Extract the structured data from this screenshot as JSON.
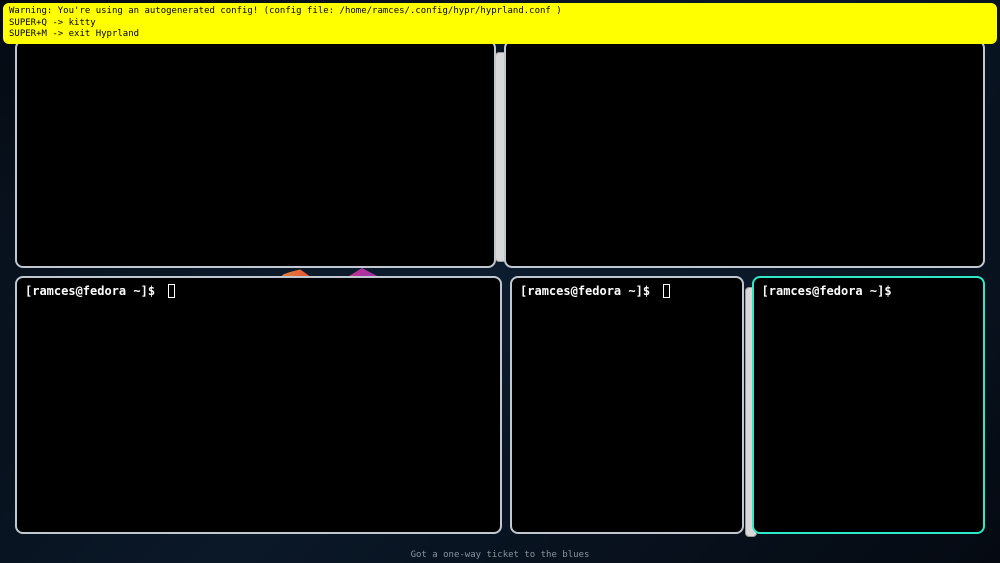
{
  "warning": {
    "line1": "Warning: You're using an autogenerated config! (config file: /home/ramces/.config/hypr/hyprland.conf )",
    "line2": "SUPER+Q -> kitty",
    "line3": "SUPER+M -> exit Hyprland"
  },
  "terminals": {
    "top_left": {
      "prompt": ""
    },
    "top_right": {
      "prompt": ""
    },
    "bottom_1": {
      "prompt": "[ramces@fedora ~]$ "
    },
    "bottom_2": {
      "prompt": "[ramces@fedora ~]$ "
    },
    "bottom_3": {
      "prompt": "[ramces@fedora ~]$ "
    }
  },
  "footer": {
    "text": "Got a one-way ticket to the blues"
  },
  "colors": {
    "warning_bg": "#ffff00",
    "terminal_bg": "#000000",
    "border_inactive": "#bfc8d0",
    "border_active": "#2ee8c8"
  }
}
